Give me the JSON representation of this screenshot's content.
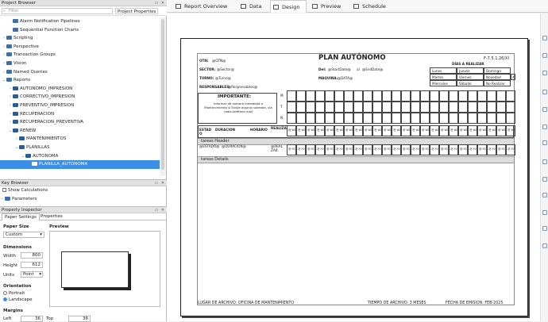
{
  "project_browser": {
    "title": "Project Browser",
    "filter_placeholder": "Filter",
    "properties_label": "Project Properties",
    "items": [
      {
        "label": "Alarm Notification Pipelines",
        "indent": 1
      },
      {
        "label": "Sequential Function Charts",
        "indent": 1
      },
      {
        "label": "Scripting",
        "indent": 0
      },
      {
        "label": "Perspective",
        "indent": 0
      },
      {
        "label": "Transaction Groups",
        "indent": 0
      },
      {
        "label": "Vision",
        "indent": 0
      },
      {
        "label": "Named Queries",
        "indent": 0
      },
      {
        "label": "Reports",
        "indent": 0
      },
      {
        "label": "AUTONOMO_IMPRESION",
        "indent": 1
      },
      {
        "label": "CORRECTIVO_IMPRESION",
        "indent": 1
      },
      {
        "label": "PREVENTIVO_IMPRESION",
        "indent": 1
      },
      {
        "label": "RECUPERACION",
        "indent": 1
      },
      {
        "label": "RECUPERACION_PREVENTIVA",
        "indent": 1
      },
      {
        "label": "RENEW",
        "indent": 1
      },
      {
        "label": "MANTENIMIENTOS",
        "indent": 2
      },
      {
        "label": "PLANILLAS",
        "indent": 2
      },
      {
        "label": "AUTONOMA",
        "indent": 3
      },
      {
        "label": "PLANILLA_AUTONOMA",
        "indent": 4
      }
    ]
  },
  "key_browser": {
    "title": "Key Browser",
    "show_calculations": "Show Calculations",
    "parameters": "Parameters"
  },
  "property_inspector": {
    "title": "Property Inspector",
    "tabs": [
      "Paper Settings",
      "Properties"
    ],
    "paper_size_label": "Paper Size",
    "paper_size_value": "Custom",
    "preview_label": "Preview",
    "dimensions_label": "Dimensions",
    "width_label": "Width",
    "width_value": "800",
    "height_label": "Height",
    "height_value": "612",
    "units_label": "Units",
    "units_value": "Point",
    "orientation_label": "Orientation",
    "portrait": "Portrait",
    "landscape": "Landscape",
    "margins_label": "Margins",
    "left_label": "Left",
    "left_value": "36",
    "top_label": "Top",
    "top_value": "36"
  },
  "top_tabs": [
    "Report Overview",
    "Data",
    "Design",
    "Preview",
    "Schedule"
  ],
  "report": {
    "title": "PLAN AUTÓNOMO",
    "code": "F-7.5.1.26/XI",
    "otn": "OTN:",
    "otn_val": "@OTN@",
    "sector": "SECTOR:",
    "sector_val": "@Sector@",
    "turno": "TURNO:",
    "turno_val": "@Turno@",
    "responsables": "RESPONSABLES:",
    "responsables_val": "@Responsables@",
    "del": "Del:",
    "del_val": "@StartDate@",
    "al": "al",
    "al_val": "@EndDate@",
    "maquina": "MAQUINA:",
    "maquina_val": "@DATA@",
    "dias_title": "DÍAS A REALIZAR",
    "dias": [
      "Lunes",
      "Jueves",
      "Domingo",
      "Martes",
      "Viernes",
      "Novedad",
      "Miercoles",
      "Sábado",
      "No Realizar"
    ],
    "dias_x": "X",
    "importante": "IMPORTANTE:",
    "importante_text": "Informar de manera inmediata a Mantenimiento si Existe alguna novedad, vía radio-teléfono mail",
    "rows_mtn": [
      "M",
      "T",
      "N"
    ],
    "estado": "ESTAD O",
    "duracion": "DURACION",
    "horario": "HORARIO",
    "realiza": "REALIZA",
    "day_cell": "@ W0",
    "header_band": "tareas Header",
    "header_estado": "@ESTADO@",
    "header_duracion": "@DURACION@",
    "header_realiza": "@REAL ZAB",
    "header_cell": "@ F0",
    "details_band": "tareas Details",
    "footer_archivo": "LUGAR DE ARCHIVO: OFICINA DE MANTENIMIENTO",
    "footer_tiempo": "TIEMPO DE ARCHIVO: 3 MESES",
    "footer_fecha": "FECHA DE EMISION: FEB-2025"
  }
}
